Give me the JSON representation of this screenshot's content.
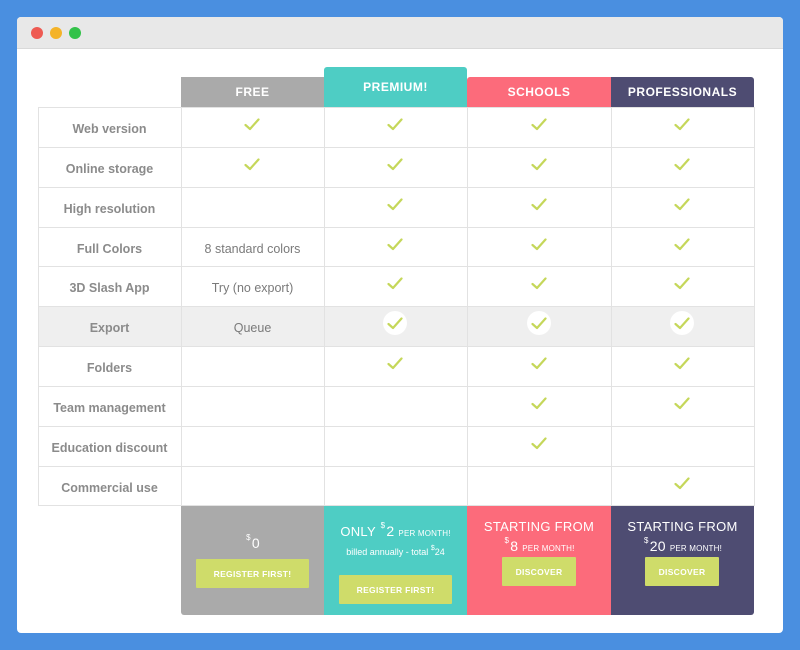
{
  "window": {
    "controls": [
      "close",
      "minimize",
      "maximize"
    ]
  },
  "plans": [
    {
      "name": "FREE",
      "color": "#aaaaaa"
    },
    {
      "name": "PREMIUM!",
      "color": "#4ecdc4"
    },
    {
      "name": "SCHOOLS",
      "color": "#fc6b7b"
    },
    {
      "name": "PROFESSIONALS",
      "color": "#4e4c72"
    }
  ],
  "features": [
    {
      "label": "Web version",
      "cells": [
        "check",
        "check",
        "check",
        "check"
      ]
    },
    {
      "label": "Online storage",
      "cells": [
        "check",
        "check",
        "check",
        "check"
      ]
    },
    {
      "label": "High resolution",
      "cells": [
        "",
        "check",
        "check",
        "check"
      ]
    },
    {
      "label": "Full Colors",
      "cells": [
        "8 standard colors",
        "check",
        "check",
        "check"
      ]
    },
    {
      "label": "3D Slash App",
      "cells": [
        "Try (no export)",
        "check",
        "check",
        "check"
      ]
    },
    {
      "label": "Export",
      "cells": [
        "Queue",
        "check-circle",
        "check-circle",
        "check-circle"
      ],
      "highlight": true
    },
    {
      "label": "Folders",
      "cells": [
        "",
        "check",
        "check",
        "check"
      ]
    },
    {
      "label": "Team management",
      "cells": [
        "",
        "",
        "check",
        "check"
      ]
    },
    {
      "label": "Education discount",
      "cells": [
        "",
        "",
        "check",
        ""
      ]
    },
    {
      "label": "Commercial use",
      "cells": [
        "",
        "",
        "",
        "check"
      ]
    }
  ],
  "pricing": {
    "free": {
      "currency": "$",
      "amount": "0",
      "button": "REGISTER FIRST!"
    },
    "premium": {
      "prefix": "ONLY",
      "currency": "$",
      "amount": "2",
      "period": "PER MONTH!",
      "billed": "billed annually - total",
      "billed_currency": "$",
      "billed_amount": "24",
      "button": "REGISTER FIRST!"
    },
    "schools": {
      "prefix": "STARTING FROM",
      "currency": "$",
      "amount": "8",
      "period": "PER MONTH!",
      "button": "DISCOVER"
    },
    "professionals": {
      "prefix": "STARTING FROM",
      "currency": "$",
      "amount": "20",
      "period": "PER MONTH!",
      "button": "DISCOVER"
    }
  },
  "colors": {
    "check": "#c5d75a",
    "button": "#cfdc6a",
    "background": "#4a8fe0"
  }
}
